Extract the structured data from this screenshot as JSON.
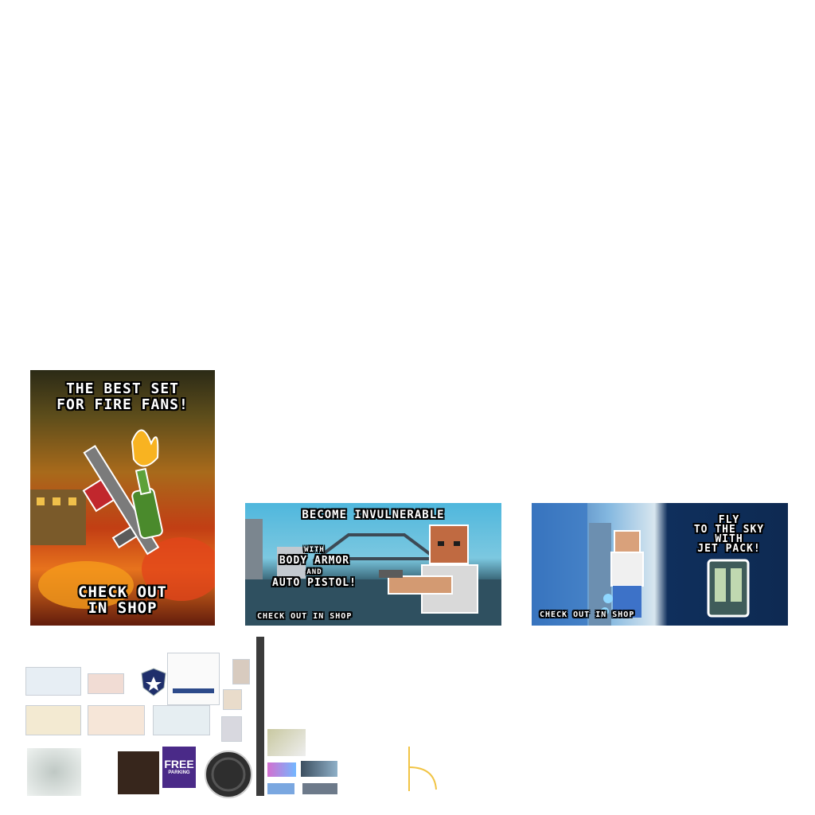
{
  "banners": {
    "fire": {
      "title_line1": "THE BEST SET",
      "title_line2": "FOR FIRE FANS!",
      "cta_line1": "CHECK OUT",
      "cta_line2": "IN SHOP",
      "colors": {
        "sky": "#2b2a16",
        "flame": "#e7731d",
        "ember": "#c23e14"
      }
    },
    "armor": {
      "title": "BECOME INVULNERABLE",
      "line1": "WITH",
      "line2": "BODY ARMOR",
      "line3": "AND",
      "line4": "AUTO PISTOL!",
      "cta": "CHECK OUT IN SHOP",
      "colors": {
        "sky": "#4fb7dd",
        "ground": "#2f5060"
      }
    },
    "jetpack": {
      "line1": "FLY",
      "line2": "TO THE SKY",
      "line3": "WITH",
      "line4": "JET PACK!",
      "cta": "CHECK OUT IN SHOP",
      "colors": {
        "left": "#2c5fa6",
        "right": "#0e2a52"
      }
    }
  },
  "atlas": {
    "badge_icon": "police-badge-icon",
    "parking_sign_line1": "FREE",
    "parking_sign_line2": "PARKING",
    "manhole_icon": "manhole-cover-icon"
  }
}
